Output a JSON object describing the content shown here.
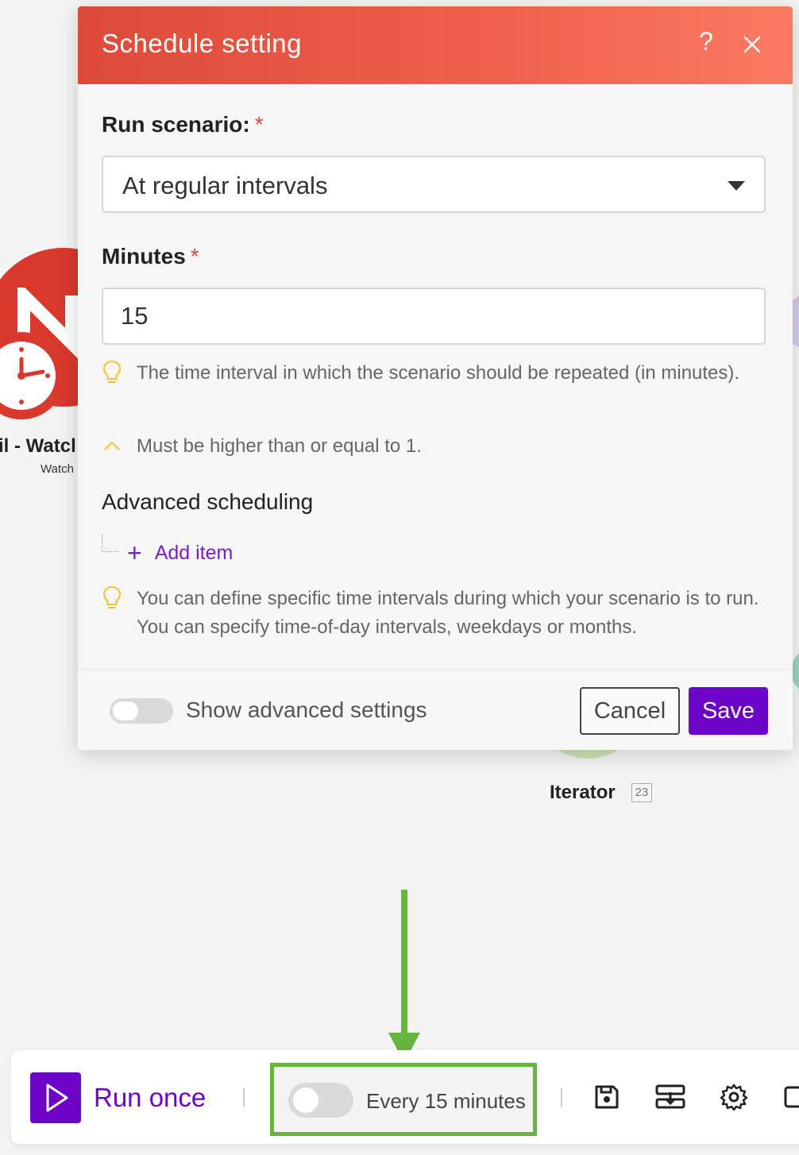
{
  "dialog": {
    "title": "Schedule setting",
    "help_label": "?",
    "run_scenario_label": "Run scenario:",
    "required_mark": "*",
    "run_scenario_value": "At regular intervals",
    "minutes_label": "Minutes",
    "minutes_value": "15",
    "hint_interval": "The time interval in which the scenario should be repeated (in minutes).",
    "hint_minimum": "Must be higher than or equal to 1.",
    "advanced_scheduling_title": "Advanced scheduling",
    "add_item_label": "Add item",
    "hint_advanced": "You can define specific time intervals during which your scenario is to run. You can specify time-of-day intervals, weekdays or months.",
    "show_advanced_label": "Show advanced settings",
    "show_advanced_enabled": false,
    "cancel_label": "Cancel",
    "save_label": "Save"
  },
  "canvas": {
    "watch_module_label": "il - Watcl",
    "watch_module_sublabel": "Watch",
    "iterator_label": "Iterator",
    "iterator_count": "23"
  },
  "toolbar": {
    "run_once_label": "Run once",
    "schedule_enabled": false,
    "schedule_label": "Every 15 minutes",
    "icons": [
      "save-icon",
      "explain-flow-icon",
      "settings-gear-icon",
      "notes-icon"
    ]
  },
  "colors": {
    "accent_purple": "#6d05c8",
    "header_red": "#dd4a3a",
    "header_coral": "#fb7a62",
    "required_red": "#e0453a",
    "annotation_green": "#67b43e",
    "hint_yellow": "#f2c230"
  }
}
